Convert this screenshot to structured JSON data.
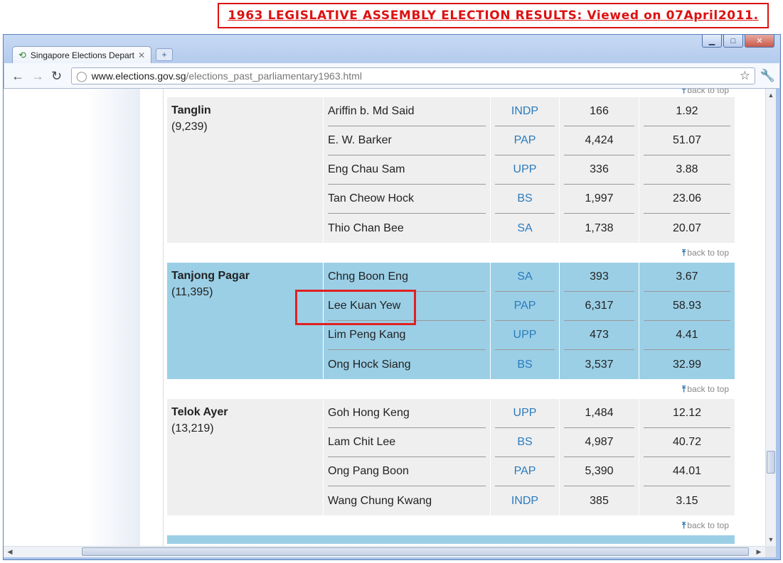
{
  "caption": "1963 LEGISLATIVE ASSEMBLY ELECTION RESULTS: Viewed on 07April2011.",
  "browser": {
    "tab_title": "Singapore Elections Depart...",
    "url_host": "www.elections.gov.sg",
    "url_path": "/elections_past_parliamentary1963.html"
  },
  "back_to_top_label": "back to top",
  "constituencies": [
    {
      "name": "Tanglin",
      "electors": "(9,239)",
      "style": "gray",
      "candidates": [
        {
          "name": "Ariffin b. Md Said",
          "party": "INDP",
          "votes": "166",
          "percent": "1.92"
        },
        {
          "name": "E. W. Barker",
          "party": "PAP",
          "votes": "4,424",
          "percent": "51.07"
        },
        {
          "name": "Eng Chau Sam",
          "party": "UPP",
          "votes": "336",
          "percent": "3.88"
        },
        {
          "name": "Tan Cheow Hock",
          "party": "BS",
          "votes": "1,997",
          "percent": "23.06"
        },
        {
          "name": "Thio Chan Bee",
          "party": "SA",
          "votes": "1,738",
          "percent": "20.07"
        }
      ]
    },
    {
      "name": "Tanjong Pagar",
      "electors": "(11,395)",
      "style": "blue",
      "candidates": [
        {
          "name": "Chng Boon Eng",
          "party": "SA",
          "votes": "393",
          "percent": "3.67"
        },
        {
          "name": "Lee Kuan Yew",
          "party": "PAP",
          "votes": "6,317",
          "percent": "58.93"
        },
        {
          "name": "Lim Peng Kang",
          "party": "UPP",
          "votes": "473",
          "percent": "4.41"
        },
        {
          "name": "Ong Hock Siang",
          "party": "BS",
          "votes": "3,537",
          "percent": "32.99"
        }
      ]
    },
    {
      "name": "Telok Ayer",
      "electors": "(13,219)",
      "style": "gray",
      "candidates": [
        {
          "name": "Goh Hong Keng",
          "party": "UPP",
          "votes": "1,484",
          "percent": "12.12"
        },
        {
          "name": "Lam Chit Lee",
          "party": "BS",
          "votes": "4,987",
          "percent": "40.72"
        },
        {
          "name": "Ong Pang Boon",
          "party": "PAP",
          "votes": "5,390",
          "percent": "44.01"
        },
        {
          "name": "Wang Chung Kwang",
          "party": "INDP",
          "votes": "385",
          "percent": "3.15"
        }
      ]
    }
  ]
}
